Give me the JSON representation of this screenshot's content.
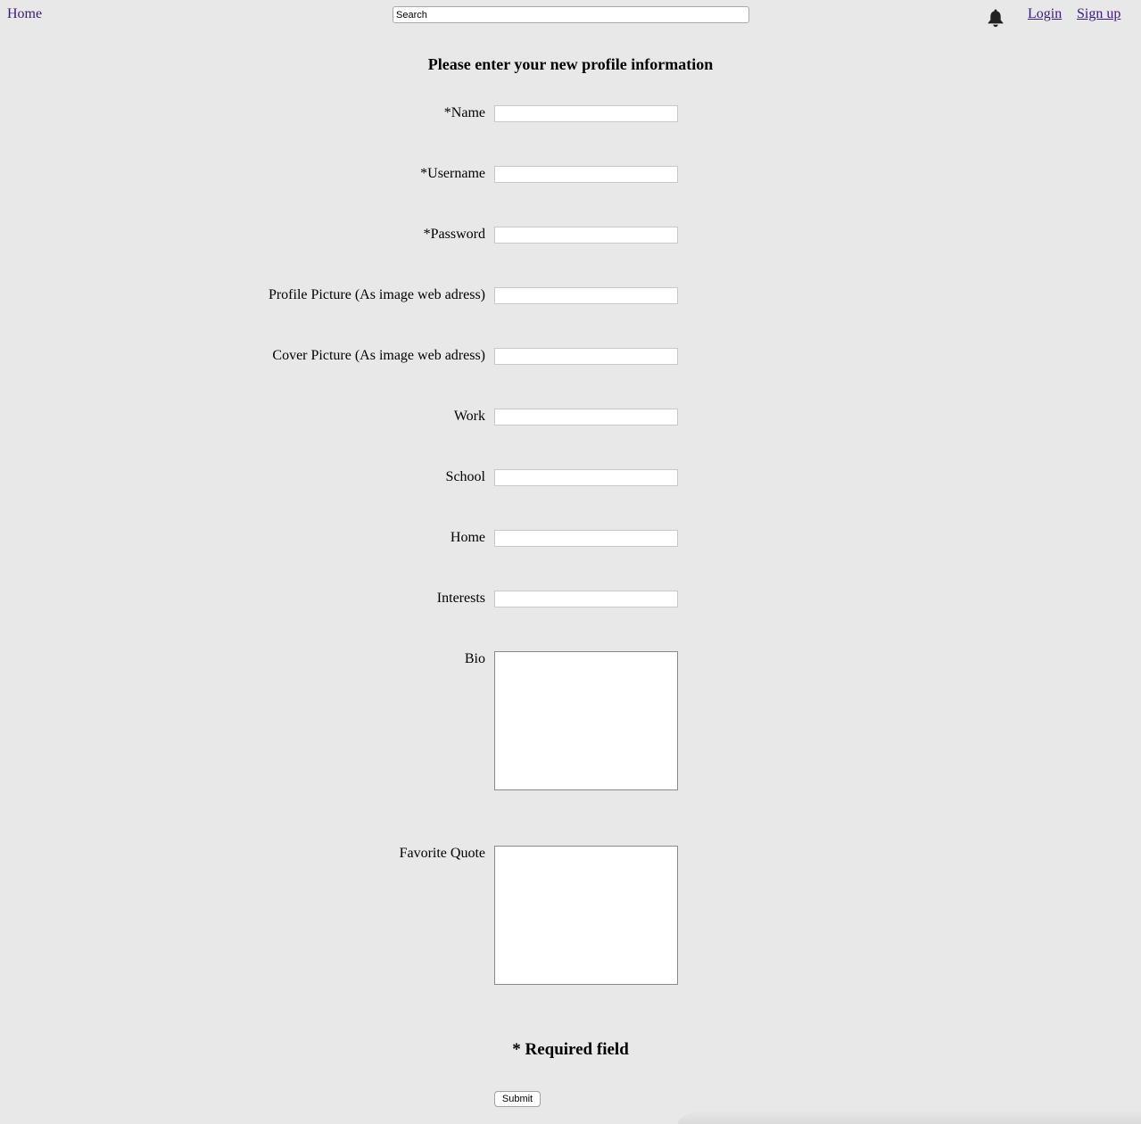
{
  "nav": {
    "home_label": "Home",
    "search_placeholder": "Search",
    "bell_icon": "bell-icon",
    "login_label": "Login",
    "signup_label": "Sign up",
    "link_color": "#3c1a78"
  },
  "form": {
    "title": "Please enter your new profile information",
    "fields": {
      "name": {
        "label": "*Name",
        "value": ""
      },
      "username": {
        "label": "*Username",
        "value": ""
      },
      "password": {
        "label": "*Password",
        "value": ""
      },
      "profile_picture": {
        "label": "Profile Picture (As image web adress)",
        "value": ""
      },
      "cover_picture": {
        "label": "Cover Picture (As image web adress)",
        "value": ""
      },
      "work": {
        "label": "Work",
        "value": ""
      },
      "school": {
        "label": "School",
        "value": ""
      },
      "home": {
        "label": "Home",
        "value": ""
      },
      "interests": {
        "label": "Interests",
        "value": ""
      },
      "bio": {
        "label": "Bio",
        "value": ""
      },
      "favorite_quote": {
        "label": "Favorite Quote",
        "value": ""
      }
    },
    "required_note": "* Required field",
    "submit_label": "Submit"
  },
  "colors": {
    "background": "#e8e8e8"
  }
}
